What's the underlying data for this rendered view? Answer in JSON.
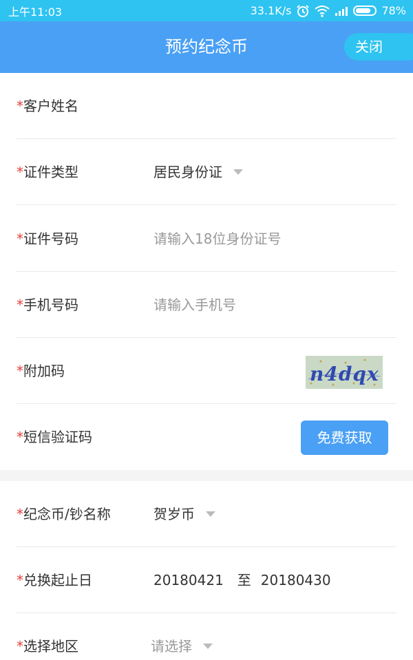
{
  "status_bar": {
    "time": "上午11:03",
    "network_speed": "33.1K/s",
    "battery_percent": "78%",
    "battery_level": 0.78,
    "icons": [
      "alarm-icon",
      "wifi-icon",
      "signal-icon",
      "battery-icon"
    ]
  },
  "header": {
    "title": "预约纪念币",
    "close_label": "关闭",
    "bg_color": "#4aa0f5",
    "accent_color": "#2ec3f0"
  },
  "form": {
    "required_mark": "*",
    "customer_name": {
      "label": "客户姓名"
    },
    "id_type": {
      "label": "证件类型",
      "value": "居民身份证"
    },
    "id_number": {
      "label": "证件号码",
      "placeholder": "请输入18位身份证号"
    },
    "phone": {
      "label": "手机号码",
      "placeholder": "请输入手机号"
    },
    "captcha": {
      "label": "附加码",
      "image_text": "n4dqx"
    },
    "sms_code": {
      "label": "短信验证码",
      "button_label": "免费获取"
    },
    "coin_name": {
      "label": "纪念币/钞名称",
      "value": "贺岁币"
    },
    "exchange_dates": {
      "label": "兑换起止日",
      "start": "20180421",
      "separator": "至",
      "end": "20180430"
    },
    "region": {
      "label": "选择地区",
      "placeholder": "请选择"
    }
  }
}
